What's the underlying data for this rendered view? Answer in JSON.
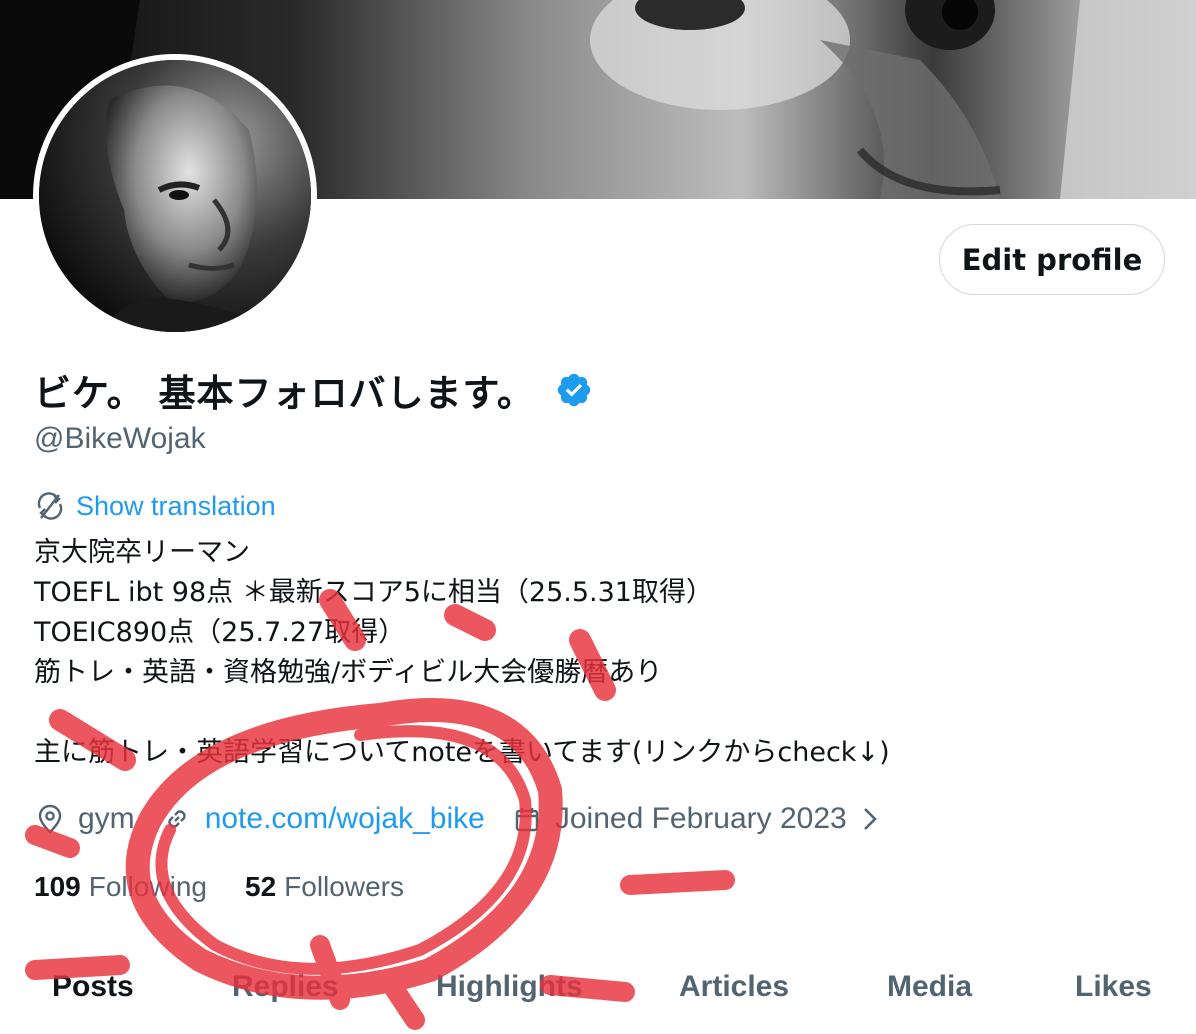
{
  "profile": {
    "name": "ビケ。 基本フォロバします。",
    "handle": "@BikeWojak",
    "edit_button": "Edit profile",
    "show_translation": "Show translation",
    "bio_lines": [
      "京大院卒リーマン",
      "TOEFL ibt 98点 ＊最新スコア5に相当（25.5.31取得）",
      "TOEIC890点（25.7.27取得）",
      "筋トレ・英語・資格勉強/ボディビル大会優勝暦あり",
      "",
      "主に筋トレ・英語学習についてnoteを書いてます(リンクからcheck↓)"
    ],
    "location": "gym",
    "website": "note.com/wojak_bike",
    "joined": "Joined February 2023",
    "following_count": "109",
    "following_label": "Following",
    "followers_count": "52",
    "followers_label": "Followers"
  },
  "tabs": [
    "Posts",
    "Replies",
    "Highlights",
    "Articles",
    "Media",
    "Likes"
  ],
  "active_tab": "Posts",
  "icons": {
    "verified": "verified-badge-icon",
    "translate": "translate-icon",
    "location": "location-pin-icon",
    "link": "link-icon",
    "calendar": "calendar-icon",
    "chevron": "chevron-right-icon"
  },
  "colors": {
    "accent": "#1d9bf0",
    "text_primary": "#0f1419",
    "text_secondary": "#536471",
    "annotation": "#e8323c"
  }
}
